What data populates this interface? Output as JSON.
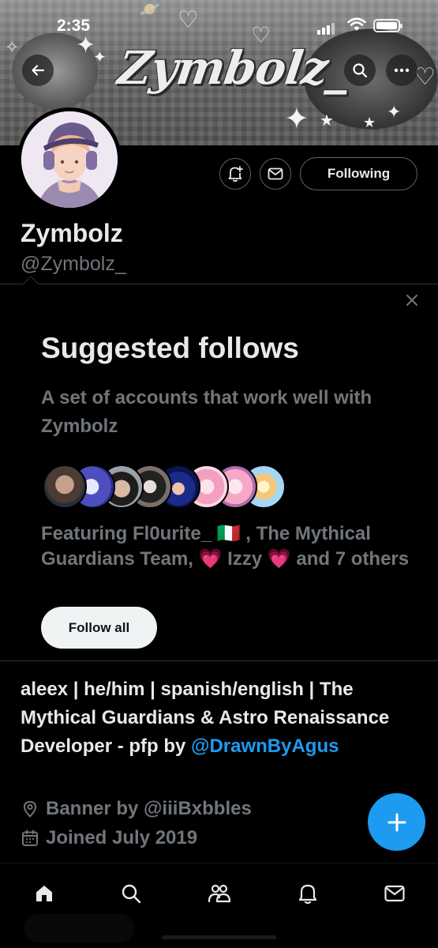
{
  "status_bar": {
    "time": "2:35"
  },
  "banner": {
    "title_art": "Zymbolz_"
  },
  "header": {
    "back_icon": "arrow-left-icon",
    "search_icon": "search-icon",
    "more_icon": "more-horizontal-icon"
  },
  "profile": {
    "display_name": "Zymbolz",
    "handle": "@Zymbolz_",
    "following_label": "Following",
    "notify_icon": "bell-plus-icon",
    "message_icon": "mail-icon"
  },
  "suggested": {
    "title": "Suggested follows",
    "subtitle": "A set of accounts that work well with Zymbolz",
    "featuring": "Featuring Fl0urite_ 🇮🇹 , The Mythical Guardians Team, 💗 Izzy 💗 and 7 others",
    "follow_all_label": "Follow all",
    "close_icon": "close-icon",
    "avatar_count": 8
  },
  "bio": {
    "text": "aleex | he/him | spanish/english | The Mythical Guardians & Astro Renaissance Developer - pfp by ",
    "mention": "@DrawnByAgus",
    "location": "Banner by @iiiBxbbles",
    "joined": "Joined July 2019"
  },
  "fab": {
    "icon": "plus-icon"
  },
  "tabbar": {
    "items": [
      "home-icon",
      "search-icon",
      "communities-icon",
      "notifications-icon",
      "messages-icon"
    ]
  },
  "colors": {
    "accent": "#1d9bf0",
    "muted": "#71767b",
    "background": "#000000",
    "text": "#e7e9ea"
  }
}
